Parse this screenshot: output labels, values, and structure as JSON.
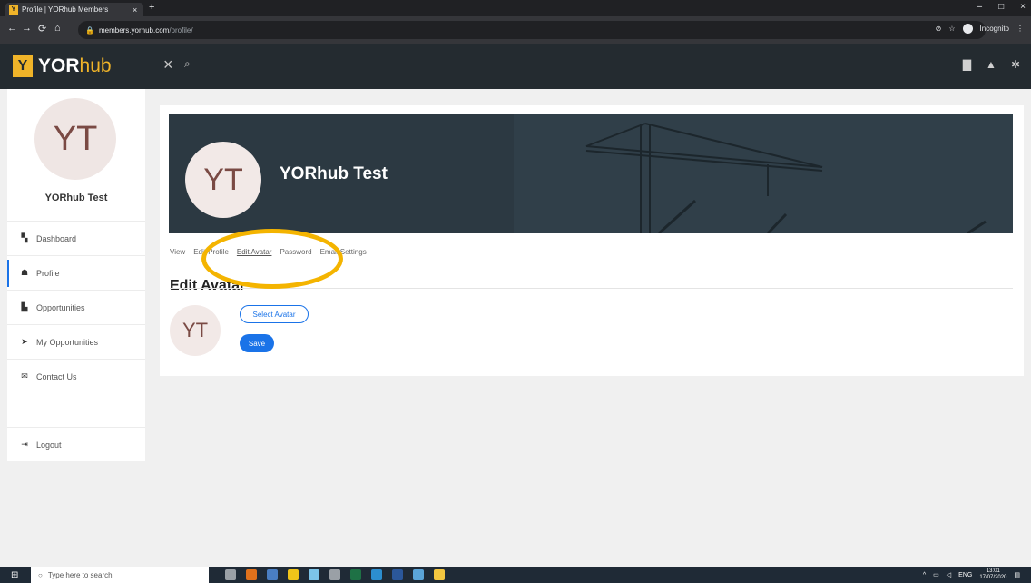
{
  "browser": {
    "tab_title": "Profile | YORhub Members",
    "tab_close": "×",
    "new_tab": "+",
    "url_host": "members.yorhub.com",
    "url_path": "/profile/",
    "incognito_label": "Incognito",
    "window_controls": [
      "–",
      "□",
      "×"
    ]
  },
  "header": {
    "logo_letter": "Y",
    "logo_bold": "YOR",
    "logo_rest": "hub",
    "close_glyph": "×"
  },
  "sidebar": {
    "avatar_initials": "YT",
    "user_name": "YORhub Test",
    "items": [
      {
        "label": "Dashboard",
        "icon": "dashboard-icon"
      },
      {
        "label": "Profile",
        "icon": "user-icon"
      },
      {
        "label": "Opportunities",
        "icon": "document-icon"
      },
      {
        "label": "My Opportunities",
        "icon": "arrow-icon"
      },
      {
        "label": "Contact Us",
        "icon": "envelope-icon"
      }
    ],
    "logout_label": "Logout"
  },
  "profile": {
    "banner_initials": "YT",
    "banner_name": "YORhub Test",
    "tabs": [
      "View",
      "Edit Profile",
      "Edit Avatar",
      "Password",
      "Email Settings"
    ],
    "section_title": "Edit Avatar",
    "avatar_initials": "YT",
    "select_label": "Select Avatar",
    "save_label": "Save"
  },
  "taskbar": {
    "search_placeholder": "Type here to search",
    "lang": "ENG",
    "time": "13:01",
    "date": "17/07/2020",
    "icon_colors": [
      "#9aa0a6",
      "#e0711c",
      "#4a7ec2",
      "#f0c419",
      "#7cc4e8",
      "#9aa0a6",
      "#1e7145",
      "#2c8ecf",
      "#2b579a",
      "#5ba4d8",
      "#f3c640"
    ]
  }
}
